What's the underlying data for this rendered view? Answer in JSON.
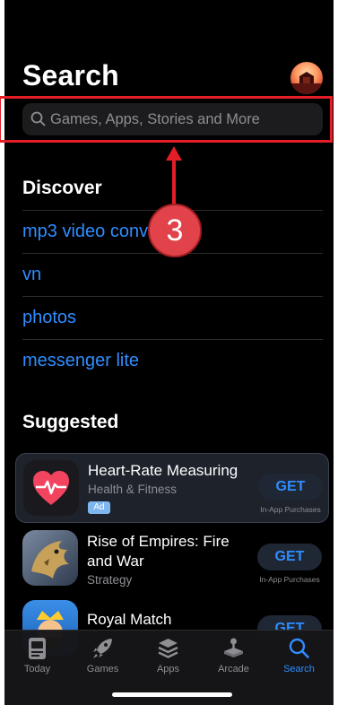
{
  "header": {
    "title": "Search"
  },
  "search": {
    "placeholder": "Games, Apps, Stories and More"
  },
  "discover": {
    "heading": "Discover",
    "items": [
      "mp3 video converter",
      "vn",
      "photos",
      "messenger lite"
    ]
  },
  "suggested": {
    "heading": "Suggested",
    "apps": [
      {
        "name": "Heart-Rate Measuring",
        "category": "Health & Fitness",
        "badge": "Ad",
        "button": "GET",
        "note": "In-App Purchases",
        "icon": "heart-rate-icon"
      },
      {
        "name_line1": "Rise of Empires: Fire",
        "name_line2": "and War",
        "category": "Strategy",
        "button": "GET",
        "note": "In-App Purchases",
        "icon": "dragon-icon"
      },
      {
        "name": "Royal Match",
        "button": "GET",
        "icon": "king-icon"
      }
    ]
  },
  "tabbar": {
    "tabs": [
      {
        "label": "Today",
        "icon": "today-icon"
      },
      {
        "label": "Games",
        "icon": "rocket-icon"
      },
      {
        "label": "Apps",
        "icon": "layers-icon"
      },
      {
        "label": "Arcade",
        "icon": "joystick-icon"
      },
      {
        "label": "Search",
        "icon": "search-icon",
        "active": true
      }
    ]
  },
  "annotation": {
    "step_number": "3"
  },
  "colors": {
    "accent": "#2f8dff",
    "annotation": "#e41e26",
    "background": "#000000"
  }
}
